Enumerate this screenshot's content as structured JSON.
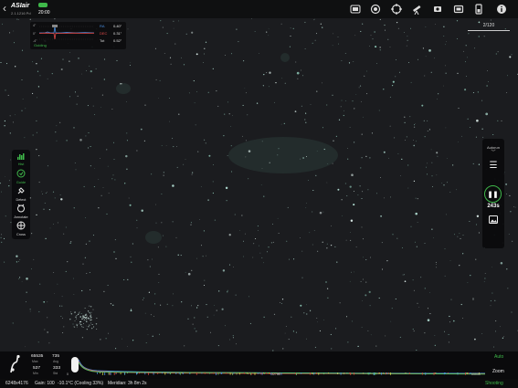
{
  "app": {
    "name": "ASIair",
    "version": "2.1.1216 Pd",
    "time": "20:00",
    "battery_color": "#3fb84a"
  },
  "topbar": {
    "icons": [
      "wifi-icon",
      "camera-icon",
      "target-icon",
      "telescope-icon",
      "focuser-icon",
      "device-icon",
      "storage-icon",
      "info-icon"
    ]
  },
  "frame_counter": "2/120",
  "guiding": {
    "axis_top": "4\"",
    "axis_mid": "0\"",
    "axis_bottom": "-4\"",
    "rows": [
      {
        "label": "RA",
        "value": "0.40\"",
        "color": "#4a90e2"
      },
      {
        "label": "DEC",
        "value": "0.31\"",
        "color": "#e24a4a"
      },
      {
        "label": "Tot",
        "value": "0.52\"",
        "color": "#dddddd"
      }
    ],
    "status": "Guiding"
  },
  "left_tools": [
    {
      "icon": "histogram-icon",
      "label": "Hist",
      "active": true
    },
    {
      "icon": "crosshair-circle-icon",
      "label": "Guide",
      "active": true
    },
    {
      "icon": "satellite-icon",
      "label": "Detect",
      "active": false
    },
    {
      "icon": "annotate-icon",
      "label": "Annotate",
      "active": false
    },
    {
      "icon": "cross-icon",
      "label": "Cross",
      "active": false
    }
  ],
  "shoot_panel": {
    "mode": "Autorun",
    "timer": "243s",
    "accent": "#3fb84a"
  },
  "histogram": {
    "max": "65535",
    "max_label": "Max",
    "avg": "735",
    "avg_label": "Avg",
    "min": "537",
    "min_label": "Min",
    "std": "333",
    "std_label": "Std",
    "auto_label": "Auto",
    "zoom_label": "Zoom",
    "tick_left": "0",
    "tick_mid": "32768",
    "tick_right": "65535"
  },
  "status": {
    "resolution": "6248x4176",
    "gain": "Gain: 100",
    "temp": "-10.1°C (Cooling 33%)",
    "meridian": "Meridian: 3h 8m 2s",
    "state": "Shooting"
  }
}
